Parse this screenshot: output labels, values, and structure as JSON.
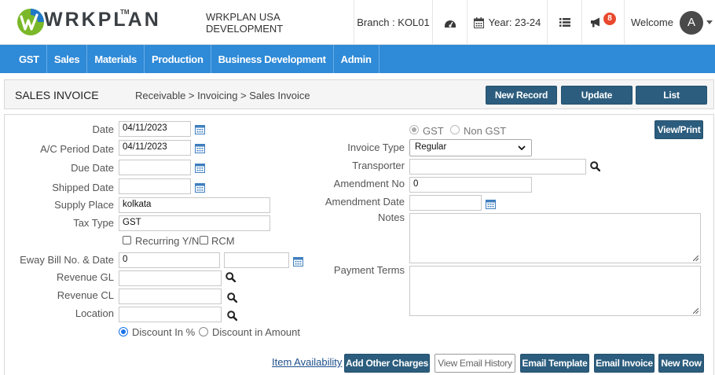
{
  "header": {
    "logo_text": "WRKPLAN",
    "logo_tm": "TM",
    "company": "WRKPLAN USA DEVELOPMENT",
    "branch": "Branch : KOL01",
    "year": "Year: 23-24",
    "notification_count": "8",
    "welcome": "Welcome",
    "avatar_initial": "A"
  },
  "nav": {
    "items": [
      "GST",
      "Sales",
      "Materials",
      "Production",
      "Business Development",
      "Admin"
    ]
  },
  "titlebar": {
    "title": "SALES INVOICE",
    "breadcrumb": "Receivable > Invoicing > Sales Invoice",
    "new_record": "New Record",
    "update": "Update",
    "list": "List"
  },
  "form": {
    "date_label": "Date",
    "date_value": "04/11/2023",
    "ac_period_label": "A/C Period Date",
    "ac_period_value": "04/11/2023",
    "due_date_label": "Due Date",
    "due_date_value": "",
    "shipped_date_label": "Shipped Date",
    "shipped_date_value": "",
    "supply_place_label": "Supply Place",
    "supply_place_value": "kolkata",
    "tax_type_label": "Tax Type",
    "tax_type_value": "GST",
    "recurring_label": "Recurring Y/N",
    "rcm_label": "RCM",
    "eway_label": "Eway Bill No. & Date",
    "eway_no_value": "0",
    "eway_date_value": "",
    "revenue_gl_label": "Revenue GL",
    "revenue_gl_value": "",
    "revenue_cl_label": "Revenue CL",
    "revenue_cl_value": "",
    "location_label": "Location",
    "location_value": "",
    "discount_pct_label": "Discount In %",
    "discount_amt_label": "Discount in Amount",
    "gst_label": "GST",
    "non_gst_label": "Non GST",
    "view_print": "View/Print",
    "invoice_type_label": "Invoice Type",
    "invoice_type_value": "Regular",
    "transporter_label": "Transporter",
    "transporter_value": "",
    "amendment_no_label": "Amendment No",
    "amendment_no_value": "0",
    "amendment_date_label": "Amendment Date",
    "amendment_date_value": "",
    "notes_label": "Notes",
    "payment_terms_label": "Payment Terms"
  },
  "footer": {
    "item_availability": "Item Availability",
    "add_other_charges": "Add Other Charges",
    "view_email_history": "View Email History",
    "email_template": "Email Template",
    "email_invoice": "Email Invoice",
    "new_row": "New Row"
  },
  "colors": {
    "nav_bg": "#2f8ad7",
    "button_bg": "#2c5d7e",
    "badge": "#e8492d",
    "logo_green": "#7ab829",
    "logo_blue": "#1f78c8"
  }
}
